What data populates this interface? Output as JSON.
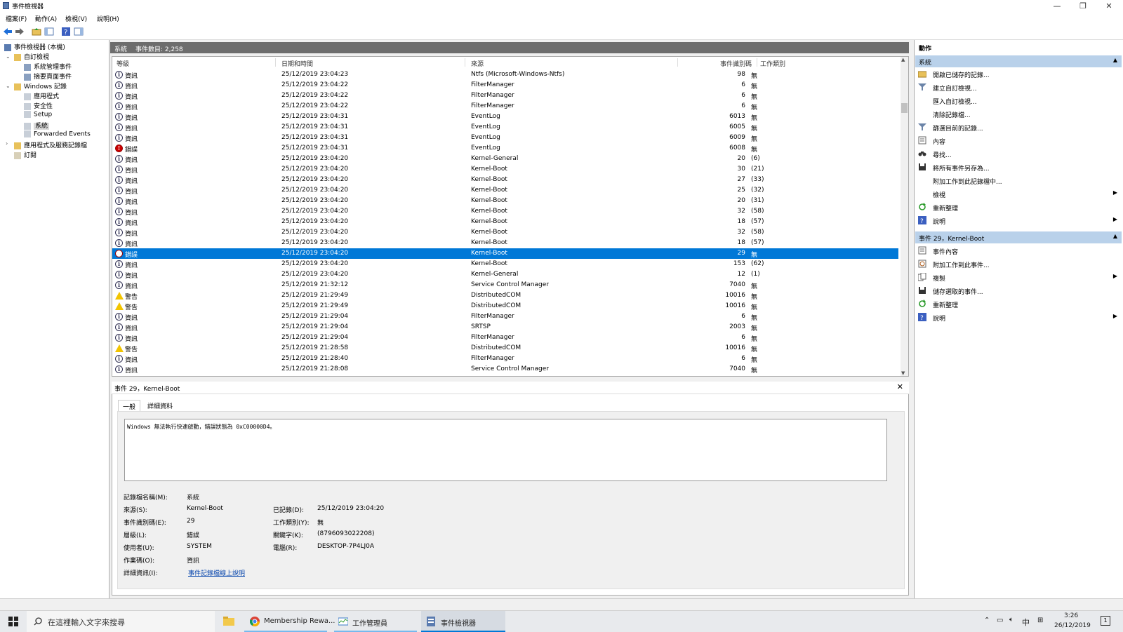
{
  "window": {
    "title": "事件檢視器"
  },
  "window_controls": {
    "minimize": "—",
    "restore": "❐",
    "close": "✕"
  },
  "menu": [
    "檔案(F)",
    "動作(A)",
    "檢視(V)",
    "說明(H)"
  ],
  "tree": {
    "root": "事件檢視器 (本機)",
    "custom_views": "自訂檢視",
    "admin_events": "系統管理事件",
    "summary_page": "摘要頁面事件",
    "windows_logs": "Windows 記錄",
    "application": "應用程式",
    "security": "安全性",
    "setup": "Setup",
    "system": "系統",
    "forwarded": "Forwarded Events",
    "app_service_logs": "應用程式及服務記錄檔",
    "subscriptions": "訂閱"
  },
  "list_header": {
    "log": "系統",
    "count": "事件數目: 2,258"
  },
  "columns": {
    "level": "等級",
    "datetime": "日期和時間",
    "source": "來源",
    "event_id": "事件識別碼",
    "task": "工作類別"
  },
  "events": [
    {
      "level": "info",
      "level_text": "資訊",
      "datetime": "25/12/2019 23:04:23",
      "source": "Ntfs (Microsoft-Windows-Ntfs)",
      "id": "98",
      "task": "無"
    },
    {
      "level": "info",
      "level_text": "資訊",
      "datetime": "25/12/2019 23:04:22",
      "source": "FilterManager",
      "id": "6",
      "task": "無"
    },
    {
      "level": "info",
      "level_text": "資訊",
      "datetime": "25/12/2019 23:04:22",
      "source": "FilterManager",
      "id": "6",
      "task": "無"
    },
    {
      "level": "info",
      "level_text": "資訊",
      "datetime": "25/12/2019 23:04:22",
      "source": "FilterManager",
      "id": "6",
      "task": "無"
    },
    {
      "level": "info",
      "level_text": "資訊",
      "datetime": "25/12/2019 23:04:31",
      "source": "EventLog",
      "id": "6013",
      "task": "無"
    },
    {
      "level": "info",
      "level_text": "資訊",
      "datetime": "25/12/2019 23:04:31",
      "source": "EventLog",
      "id": "6005",
      "task": "無"
    },
    {
      "level": "info",
      "level_text": "資訊",
      "datetime": "25/12/2019 23:04:31",
      "source": "EventLog",
      "id": "6009",
      "task": "無"
    },
    {
      "level": "error",
      "level_text": "錯誤",
      "datetime": "25/12/2019 23:04:31",
      "source": "EventLog",
      "id": "6008",
      "task": "無"
    },
    {
      "level": "info",
      "level_text": "資訊",
      "datetime": "25/12/2019 23:04:20",
      "source": "Kernel-General",
      "id": "20",
      "task": "(6)"
    },
    {
      "level": "info",
      "level_text": "資訊",
      "datetime": "25/12/2019 23:04:20",
      "source": "Kernel-Boot",
      "id": "30",
      "task": "(21)"
    },
    {
      "level": "info",
      "level_text": "資訊",
      "datetime": "25/12/2019 23:04:20",
      "source": "Kernel-Boot",
      "id": "27",
      "task": "(33)"
    },
    {
      "level": "info",
      "level_text": "資訊",
      "datetime": "25/12/2019 23:04:20",
      "source": "Kernel-Boot",
      "id": "25",
      "task": "(32)"
    },
    {
      "level": "info",
      "level_text": "資訊",
      "datetime": "25/12/2019 23:04:20",
      "source": "Kernel-Boot",
      "id": "20",
      "task": "(31)"
    },
    {
      "level": "info",
      "level_text": "資訊",
      "datetime": "25/12/2019 23:04:20",
      "source": "Kernel-Boot",
      "id": "32",
      "task": "(58)"
    },
    {
      "level": "info",
      "level_text": "資訊",
      "datetime": "25/12/2019 23:04:20",
      "source": "Kernel-Boot",
      "id": "18",
      "task": "(57)"
    },
    {
      "level": "info",
      "level_text": "資訊",
      "datetime": "25/12/2019 23:04:20",
      "source": "Kernel-Boot",
      "id": "32",
      "task": "(58)"
    },
    {
      "level": "info",
      "level_text": "資訊",
      "datetime": "25/12/2019 23:04:20",
      "source": "Kernel-Boot",
      "id": "18",
      "task": "(57)"
    },
    {
      "level": "error",
      "level_text": "錯誤",
      "datetime": "25/12/2019 23:04:20",
      "source": "Kernel-Boot",
      "id": "29",
      "task": "無",
      "selected": true
    },
    {
      "level": "info",
      "level_text": "資訊",
      "datetime": "25/12/2019 23:04:20",
      "source": "Kernel-Boot",
      "id": "153",
      "task": "(62)"
    },
    {
      "level": "info",
      "level_text": "資訊",
      "datetime": "25/12/2019 23:04:20",
      "source": "Kernel-General",
      "id": "12",
      "task": "(1)"
    },
    {
      "level": "info",
      "level_text": "資訊",
      "datetime": "25/12/2019 21:32:12",
      "source": "Service Control Manager",
      "id": "7040",
      "task": "無"
    },
    {
      "level": "warn",
      "level_text": "警告",
      "datetime": "25/12/2019 21:29:49",
      "source": "DistributedCOM",
      "id": "10016",
      "task": "無"
    },
    {
      "level": "warn",
      "level_text": "警告",
      "datetime": "25/12/2019 21:29:49",
      "source": "DistributedCOM",
      "id": "10016",
      "task": "無"
    },
    {
      "level": "info",
      "level_text": "資訊",
      "datetime": "25/12/2019 21:29:04",
      "source": "FilterManager",
      "id": "6",
      "task": "無"
    },
    {
      "level": "info",
      "level_text": "資訊",
      "datetime": "25/12/2019 21:29:04",
      "source": "SRTSP",
      "id": "2003",
      "task": "無"
    },
    {
      "level": "info",
      "level_text": "資訊",
      "datetime": "25/12/2019 21:29:04",
      "source": "FilterManager",
      "id": "6",
      "task": "無"
    },
    {
      "level": "warn",
      "level_text": "警告",
      "datetime": "25/12/2019 21:28:58",
      "source": "DistributedCOM",
      "id": "10016",
      "task": "無"
    },
    {
      "level": "info",
      "level_text": "資訊",
      "datetime": "25/12/2019 21:28:40",
      "source": "FilterManager",
      "id": "6",
      "task": "無"
    },
    {
      "level": "info",
      "level_text": "資訊",
      "datetime": "25/12/2019 21:28:08",
      "source": "Service Control Manager",
      "id": "7040",
      "task": "無"
    }
  ],
  "detail": {
    "title": "事件 29，Kernel-Boot",
    "close": "✕",
    "tabs": [
      "一般",
      "詳細資料"
    ],
    "message": "Windows 無法執行快速啟動，錯誤狀態為 0xC00000D4。",
    "fields": {
      "log_name_label": "記錄檔名稱(M):",
      "log_name": "系統",
      "source_label": "來源(S):",
      "source": "Kernel-Boot",
      "logged_label": "已記錄(D):",
      "logged": "25/12/2019 23:04:20",
      "event_id_label": "事件識別碼(E):",
      "event_id": "29",
      "task_label": "工作類別(Y):",
      "task": "無",
      "level_label": "層級(L):",
      "level": "錯誤",
      "keywords_label": "關鍵字(K):",
      "keywords": "(8796093022208)",
      "user_label": "使用者(U):",
      "user": "SYSTEM",
      "computer_label": "電腦(R):",
      "computer": "DESKTOP-7P4LJ0A",
      "opcode_label": "作業碼(O):",
      "opcode": "資訊",
      "more_info_label": "詳細資訊(I):",
      "more_info": "事件記錄檔線上說明"
    }
  },
  "actions": {
    "header": "動作",
    "section1": "系統",
    "section1_items": [
      {
        "label": "開啟已儲存的記錄...",
        "icon": "folder-open-icon"
      },
      {
        "label": "建立自訂檢視...",
        "icon": "filter-icon"
      },
      {
        "label": "匯入自訂檢視...",
        "icon": ""
      },
      {
        "label": "清除記錄檔...",
        "icon": ""
      },
      {
        "label": "篩選目前的記錄...",
        "icon": "filter-icon"
      },
      {
        "label": "內容",
        "icon": "properties-icon"
      },
      {
        "label": "尋找...",
        "icon": "binoculars-icon"
      },
      {
        "label": "將所有事件另存為...",
        "icon": "save-icon"
      },
      {
        "label": "附加工作到此記錄檔中...",
        "icon": ""
      },
      {
        "label": "檢視",
        "icon": "",
        "submenu": true
      },
      {
        "label": "重新整理",
        "icon": "refresh-icon"
      },
      {
        "label": "說明",
        "icon": "help-icon",
        "submenu": true
      }
    ],
    "section2": "事件 29，Kernel-Boot",
    "section2_items": [
      {
        "label": "事件內容",
        "icon": "properties-icon"
      },
      {
        "label": "附加工作到此事件...",
        "icon": "task-icon"
      },
      {
        "label": "複製",
        "icon": "copy-icon",
        "submenu": true
      },
      {
        "label": "儲存選取的事件...",
        "icon": "save-icon"
      },
      {
        "label": "重新整理",
        "icon": "refresh-icon"
      },
      {
        "label": "說明",
        "icon": "help-icon",
        "submenu": true
      }
    ]
  },
  "taskbar": {
    "search_placeholder": "在這裡輸入文字來搜尋",
    "apps": [
      "Membership Rewa...",
      "工作管理員",
      "事件檢視器"
    ],
    "ime": "中",
    "time": "3:26",
    "date": "26/12/2019",
    "notif_count": "1"
  },
  "colors": {
    "selection": "#0078d7",
    "section_header": "#b9d1ea",
    "list_header": "#6d6d6d"
  }
}
